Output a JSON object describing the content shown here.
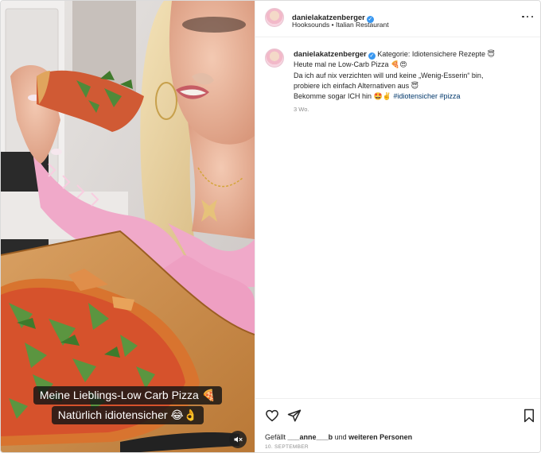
{
  "header": {
    "username": "danielakatzenberger",
    "audio": "Hooksounds",
    "separator": "•",
    "location": "Italian Restaurant"
  },
  "post": {
    "username": "danielakatzenberger",
    "lines": [
      "Kategorie: Idiotensichere Rezepte 😇",
      "Heute mal ne Low-Carb Pizza 🍕😍",
      "Da ich auf nix verzichten will und keine „Wenig-Esserin“ bin,",
      "probiere ich einfach Alternativen aus 😇",
      "Bekomme sogar ICH hin 🤩✌️"
    ],
    "hashtags": [
      "#idiotensicher",
      "#pizza"
    ],
    "time_ago": "3 Wo."
  },
  "video_captions": {
    "line1": "Meine Lieblings-Low Carb Pizza 🍕",
    "line2": "Natürlich idiotensicher 😂👌"
  },
  "footer": {
    "liked_by_prefix": "Gefällt",
    "liked_by_user": "___anne___b",
    "liked_by_connector": "und",
    "liked_by_others": "weiteren Personen",
    "date": "10. SEPTEMBER"
  },
  "icons": {
    "verified": "verified-badge-icon",
    "like": "heart-outline-icon",
    "share": "paper-plane-icon",
    "save": "bookmark-outline-icon",
    "more": "more-horizontal-icon",
    "mute": "speaker-muted-icon"
  },
  "colors": {
    "verified_blue": "#3897f0",
    "hashtag": "#00376b",
    "secondary_text": "#8e8e8e",
    "sweater_pink": "#f0a9c9"
  }
}
